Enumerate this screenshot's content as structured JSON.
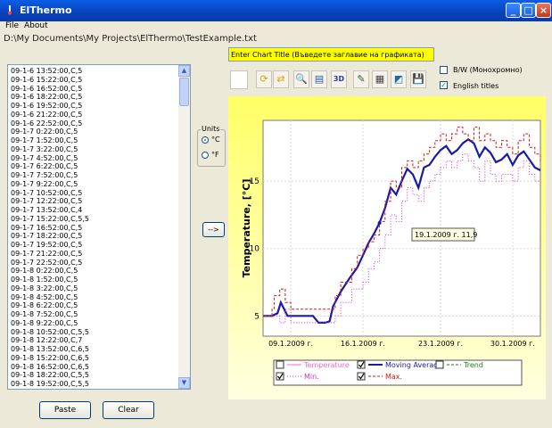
{
  "window": {
    "title": "ElThermo"
  },
  "menu": {
    "file": "File",
    "about": "About"
  },
  "path": "D:\\My Documents\\My Projects\\ElThermo\\TestExample.txt",
  "list": {
    "rows": [
      "09-1-6 13:52:00,C,5",
      "09-1-6 15:22:00,C,5",
      "09-1-6 16:52:00,C,5",
      "09-1-6 18:22:00,C,5",
      "09-1-6 19:52:00,C,5",
      "09-1-6 21:22:00,C,5",
      "09-1-6 22:52:00,C,5",
      "09-1-7 0:22:00,C,5",
      "09-1-7 1:52:00,C,5",
      "09-1-7 3:22:00,C,5",
      "09-1-7 4:52:00,C,5",
      "09-1-7 6:22:00,C,5",
      "09-1-7 7:52:00,C,5",
      "09-1-7 9:22:00,C,5",
      "09-1-7 10:52:00,C,5",
      "09-1-7 12:22:00,C,5",
      "09-1-7 13:52:00,C,4",
      "09-1-7 15:22:00,C,5,5",
      "09-1-7 16:52:00,C,5",
      "09-1-7 18:22:00,C,5",
      "09-1-7 19:52:00,C,5",
      "09-1-7 21:22:00,C,5",
      "09-1-7 22:52:00,C,5",
      "09-1-8 0:22:00,C,5",
      "09-1-8 1:52:00,C,5",
      "09-1-8 3:22:00,C,5",
      "09-1-8 4:52:00,C,5",
      "09-1-8 6:22:00,C,5",
      "09-1-8 7:52:00,C,5",
      "09-1-8 9:22:00,C,5",
      "09-1-8 10:52:00,C,5,5",
      "09-1-8 12:22:00,C,7",
      "09-1-8 13:52:00,C,6,5",
      "09-1-8 15:22:00,C,6,5",
      "09-1-8 16:52:00,C,6,5",
      "09-1-8 18:22:00,C,5,5",
      "09-1-8 19:52:00,C,5,5"
    ]
  },
  "buttons": {
    "paste": "Paste",
    "clear": "Clear",
    "arrow": "-->"
  },
  "units": {
    "legend": "Units",
    "celsius": "°C",
    "fahrenheit": "°F",
    "selected": "celsius"
  },
  "chart_title_input": {
    "value": "Enter Chart Title (Въведете заглавие на графиката)"
  },
  "toolbar": {
    "icons": [
      "blank-icon",
      "refresh-icon",
      "swap-icon",
      "zoom-icon",
      "page-icon",
      "3d-icon",
      "edit-chart-icon",
      "print-icon",
      "export-icon",
      "save-icon"
    ],
    "label_3d": "3D"
  },
  "options": {
    "bw": "B/W (Монохромно)",
    "bw_checked": false,
    "english": "English titles",
    "english_checked": true
  },
  "chart_data": {
    "type": "line",
    "ylabel": "Temperature, [°C]",
    "xlabel": "",
    "x_ticks": [
      "09.1.2009 г.",
      "16.1.2009 г.",
      "23.1.2009 г.",
      "30.1.2009 г."
    ],
    "y_ticks": [
      5,
      10,
      15
    ],
    "ylim": [
      3.5,
      19.5
    ],
    "xlim": [
      0,
      25
    ],
    "tooltip": "19.1.2009 г. 11,9",
    "tooltip_point": {
      "x": 10.5,
      "y": 11.9
    },
    "legend": [
      {
        "name": "Temperature",
        "checked": false,
        "color": "#ff66cc",
        "style": "solid"
      },
      {
        "name": "Moving Average",
        "checked": true,
        "color": "#1a1aaa",
        "style": "bold"
      },
      {
        "name": "Trend",
        "checked": false,
        "color": "#1a7a1a",
        "style": "dashed"
      },
      {
        "name": "Min.",
        "checked": true,
        "color": "#cc33cc",
        "style": "dotted"
      },
      {
        "name": "Max.",
        "checked": true,
        "color": "#cc1a1a",
        "style": "dashed"
      }
    ],
    "series": [
      {
        "name": "Moving Average",
        "color": "#1a1aaa",
        "x": [
          0,
          0.8,
          1.3,
          1.6,
          2.2,
          2.6,
          3.0,
          3.8,
          4.5,
          5.0,
          5.6,
          6.0,
          6.3,
          7.0,
          7.8,
          8.5,
          9.0,
          9.5,
          10.0,
          10.5,
          11.0,
          11.5,
          12.0,
          12.5,
          13.0,
          13.5,
          14.0,
          14.5,
          15.0,
          15.5,
          16.0,
          16.5,
          17.0,
          17.5,
          18.0,
          18.5,
          19.0,
          19.5,
          20.0,
          20.5,
          21.0,
          21.5,
          22.0,
          22.5,
          23.0,
          23.5,
          24.0,
          24.5,
          25.0
        ],
        "y": [
          5,
          5,
          5.2,
          6.0,
          5.0,
          5.0,
          5.0,
          5.0,
          5.0,
          4.5,
          4.5,
          4.6,
          5.7,
          6.8,
          7.8,
          8.6,
          9.5,
          10.4,
          11.1,
          11.9,
          13.0,
          14.5,
          14.0,
          15.0,
          15.9,
          15.5,
          14.5,
          16.0,
          16.2,
          16.8,
          17.3,
          17.6,
          17.0,
          17.3,
          17.8,
          18.1,
          17.8,
          16.8,
          17.5,
          17.1,
          16.4,
          16.6,
          17.0,
          16.2,
          16.9,
          17.2,
          16.6,
          16.0,
          15.8
        ]
      },
      {
        "name": "Min.",
        "color": "#cc33cc",
        "x": [
          0,
          1.0,
          1.5,
          2.0,
          2.5,
          3.0,
          4.0,
          5.0,
          6.0,
          6.5,
          7.0,
          8.0,
          9.0,
          9.5,
          10.0,
          10.5,
          11.0,
          11.5,
          12.0,
          12.5,
          13.0,
          13.5,
          14.0,
          14.5,
          15.0,
          15.5,
          16.0,
          16.5,
          17.0,
          17.5,
          18.0,
          18.5,
          19.0,
          19.5,
          20.0,
          20.5,
          21.0,
          21.5,
          22.0,
          22.5,
          23.0,
          23.5,
          24.0,
          24.5,
          25.0
        ],
        "y": [
          5,
          5,
          4.5,
          5.5,
          4.5,
          4.5,
          4.5,
          4.5,
          4.5,
          5.0,
          6.0,
          7.0,
          7.5,
          8.5,
          9.0,
          10.0,
          11.0,
          12.5,
          12.0,
          13.5,
          14.5,
          14.0,
          13.5,
          14.5,
          15.0,
          15.5,
          16.0,
          16.5,
          16.0,
          16.5,
          17.0,
          16.5,
          16.0,
          15.0,
          16.5,
          15.5,
          15.0,
          15.5,
          15.5,
          15.0,
          16.0,
          16.5,
          15.5,
          15.0,
          15.5
        ]
      },
      {
        "name": "Max.",
        "color": "#cc1a1a",
        "x": [
          0,
          0.8,
          1.0,
          1.5,
          2.0,
          2.5,
          3.0,
          4.0,
          5.0,
          6.0,
          6.5,
          7.0,
          8.0,
          8.5,
          9.0,
          9.5,
          10.0,
          10.5,
          11.0,
          11.5,
          12.0,
          12.5,
          13.0,
          13.5,
          14.0,
          14.5,
          15.0,
          15.5,
          16.0,
          16.5,
          17.0,
          17.5,
          18.0,
          18.5,
          19.0,
          19.5,
          20.0,
          20.5,
          21.0,
          21.5,
          22.0,
          22.5,
          23.0,
          23.5,
          24.0,
          24.5,
          25.0
        ],
        "y": [
          5,
          5.5,
          6.5,
          7.0,
          6.0,
          5.5,
          5.5,
          5.5,
          5.5,
          5.5,
          6.5,
          7.5,
          8.5,
          9.5,
          10.0,
          10.5,
          11.0,
          12.0,
          13.5,
          15.0,
          14.5,
          16.0,
          16.5,
          16.0,
          16.5,
          17.0,
          17.5,
          18.0,
          18.5,
          18.0,
          18.5,
          19.0,
          18.5,
          18.0,
          19.0,
          18.0,
          18.5,
          18.0,
          17.5,
          18.0,
          17.5,
          17.0,
          18.0,
          18.5,
          17.5,
          17.0,
          16.5
        ]
      }
    ]
  }
}
